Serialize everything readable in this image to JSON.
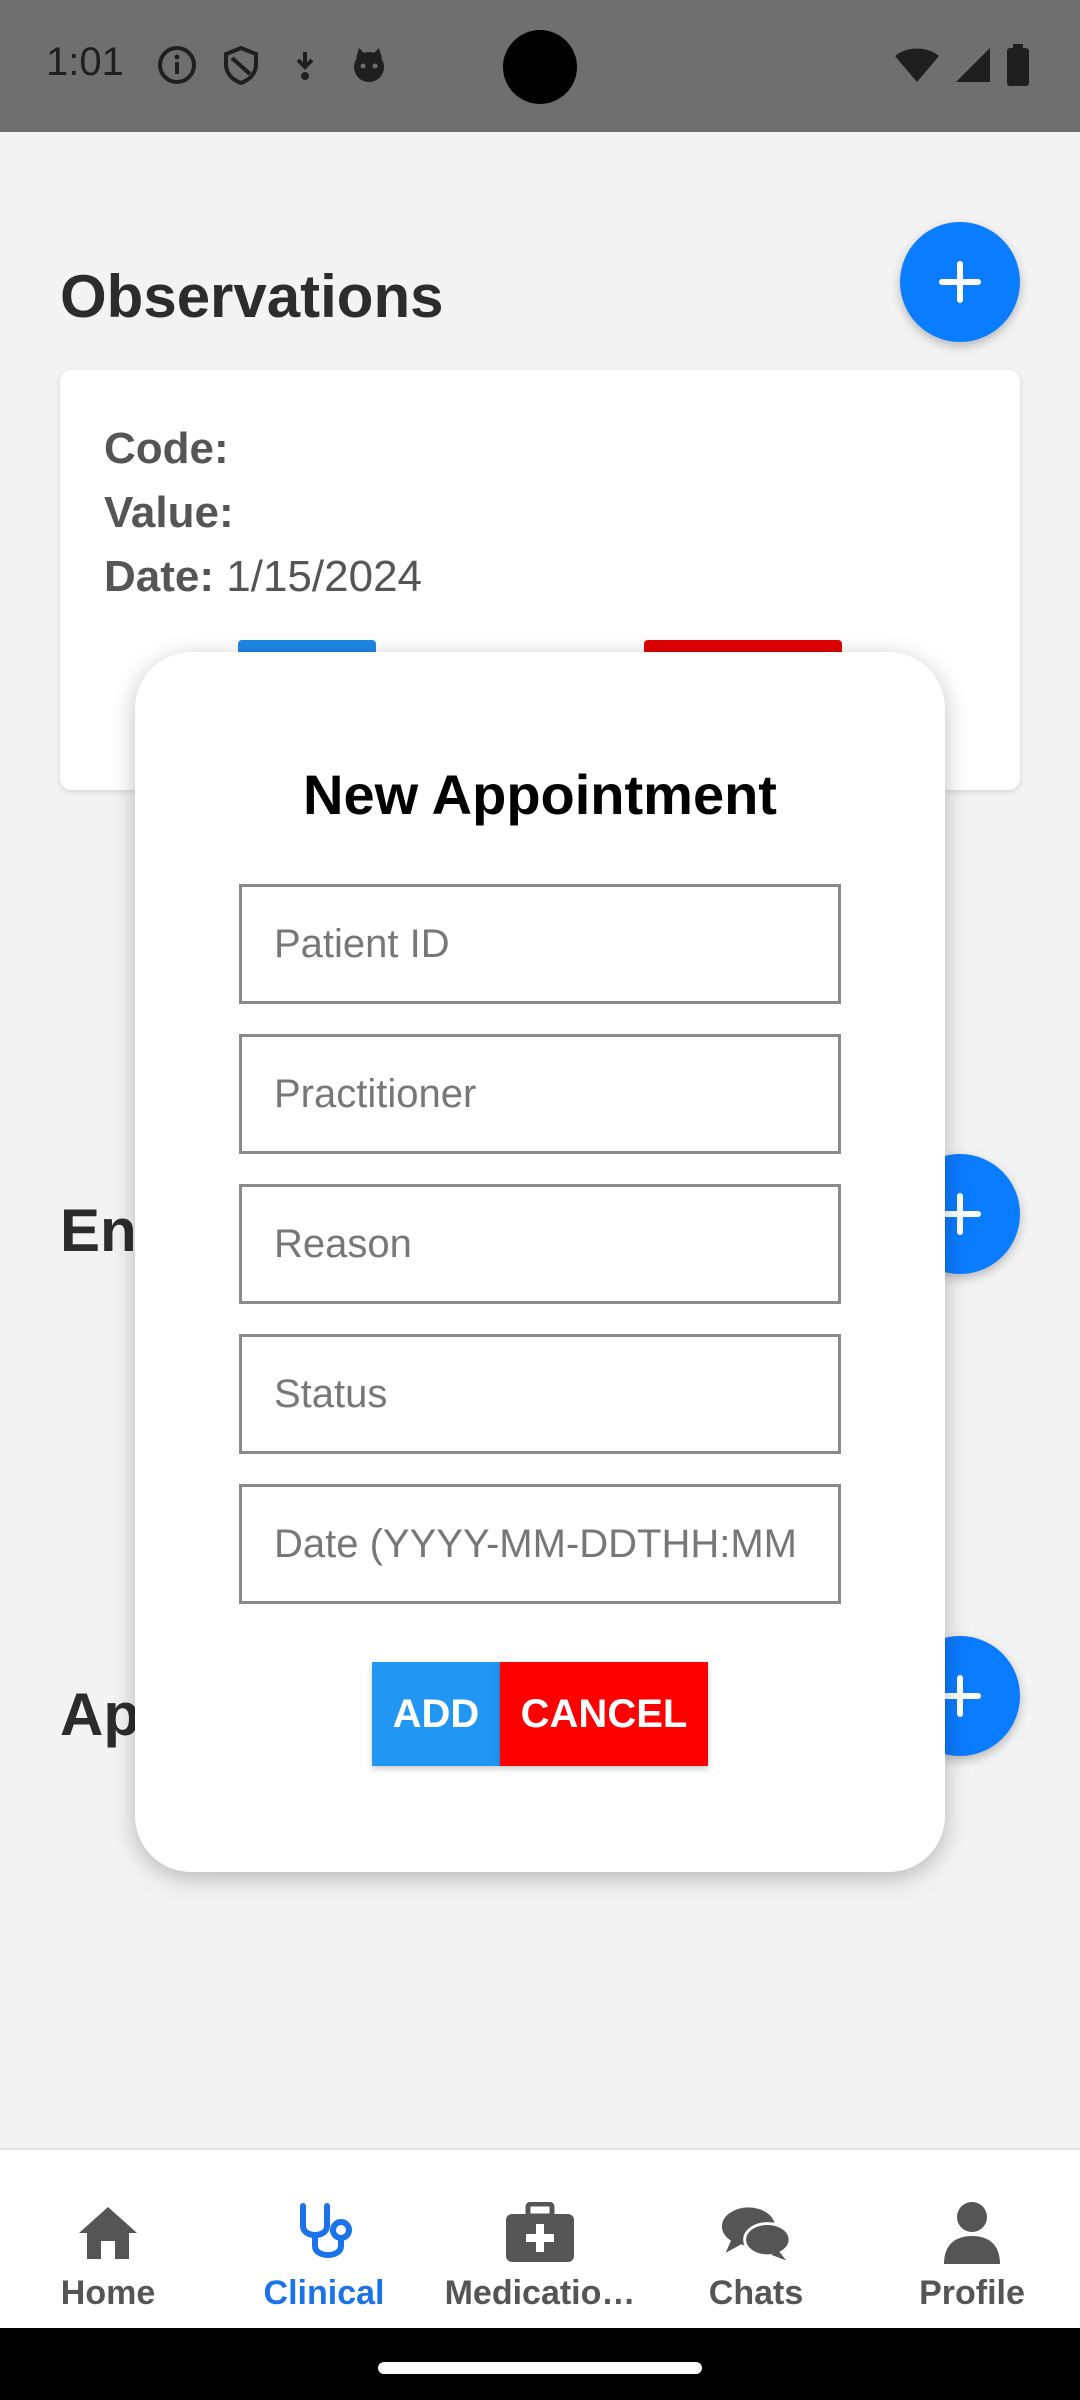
{
  "status_bar": {
    "time": "1:01"
  },
  "observations": {
    "title": "Observations",
    "code_label": "Code:",
    "code_value": "",
    "value_label": "Value:",
    "value_value": "",
    "date_label": "Date:",
    "date_value": "1/15/2024"
  },
  "encounters": {
    "title_partial": "En"
  },
  "appointments": {
    "title_partial": "Ap"
  },
  "modal": {
    "title": "New Appointment",
    "fields": {
      "patient_id": {
        "placeholder": "Patient ID",
        "value": ""
      },
      "practitioner": {
        "placeholder": "Practitioner",
        "value": ""
      },
      "reason": {
        "placeholder": "Reason",
        "value": ""
      },
      "status": {
        "placeholder": "Status",
        "value": ""
      },
      "date": {
        "placeholder": "Date (YYYY-MM-DDTHH:MM",
        "value": ""
      }
    },
    "add_label": "ADD",
    "cancel_label": "CANCEL"
  },
  "nav": {
    "items": [
      {
        "label": "Home",
        "icon": "home-icon"
      },
      {
        "label": "Clinical",
        "icon": "stethoscope-icon",
        "active": true
      },
      {
        "label": "Medicatio…",
        "icon": "medical-kit-icon"
      },
      {
        "label": "Chats",
        "icon": "chats-icon"
      },
      {
        "label": "Profile",
        "icon": "profile-icon"
      }
    ]
  },
  "colors": {
    "accent": "#0a7cff",
    "add_button": "#2196f3",
    "cancel_button": "#ff0000",
    "active_nav": "#1a73e8"
  }
}
